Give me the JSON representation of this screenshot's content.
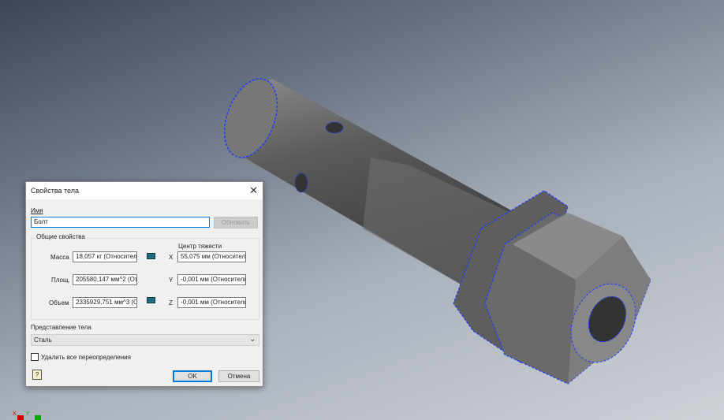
{
  "dialog": {
    "title": "Свойства тела",
    "name_label": "Имя",
    "name_value": "Болт",
    "update_button": "Обновить",
    "general_group": "Общие свойства",
    "center_label": "Центр тяжести",
    "mass_label": "Масса",
    "mass_value": "18,057 кг (Относител",
    "area_label": "Площ.",
    "area_value": "205580,147 мм^2 (От",
    "volume_label": "Объем",
    "volume_value": "2335929,751 мм^3 (О",
    "x_label": "X",
    "x_value": "55,075 мм (Относитель",
    "y_label": "Y",
    "y_value": "-0,001 мм (Относителы",
    "z_label": "Z",
    "z_value": "-0,001 мм (Относителы",
    "representation_label": "Представление тела",
    "representation_value": "Сталь",
    "delete_overrides_label": "Удалить все переопределения",
    "delete_overrides_checked": false,
    "ok": "OK",
    "cancel": "Отмена"
  },
  "axes": {
    "x": "X",
    "y": "Y"
  },
  "colors": {
    "selection": "#1a3cff",
    "accent": "#0078d7"
  }
}
